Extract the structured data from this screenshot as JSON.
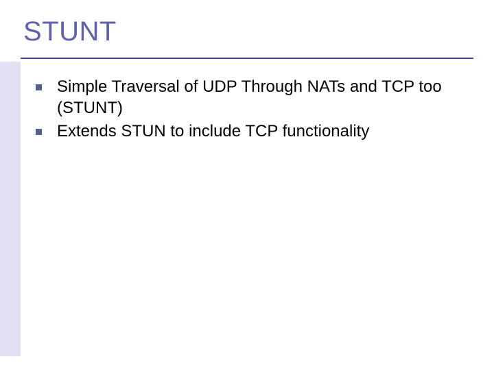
{
  "title": "STUNT",
  "bullets": [
    {
      "text": "Simple Traversal of UDP Through NATs and TCP too (STUNT)"
    },
    {
      "text": "Extends STUN to include TCP functionality"
    }
  ]
}
